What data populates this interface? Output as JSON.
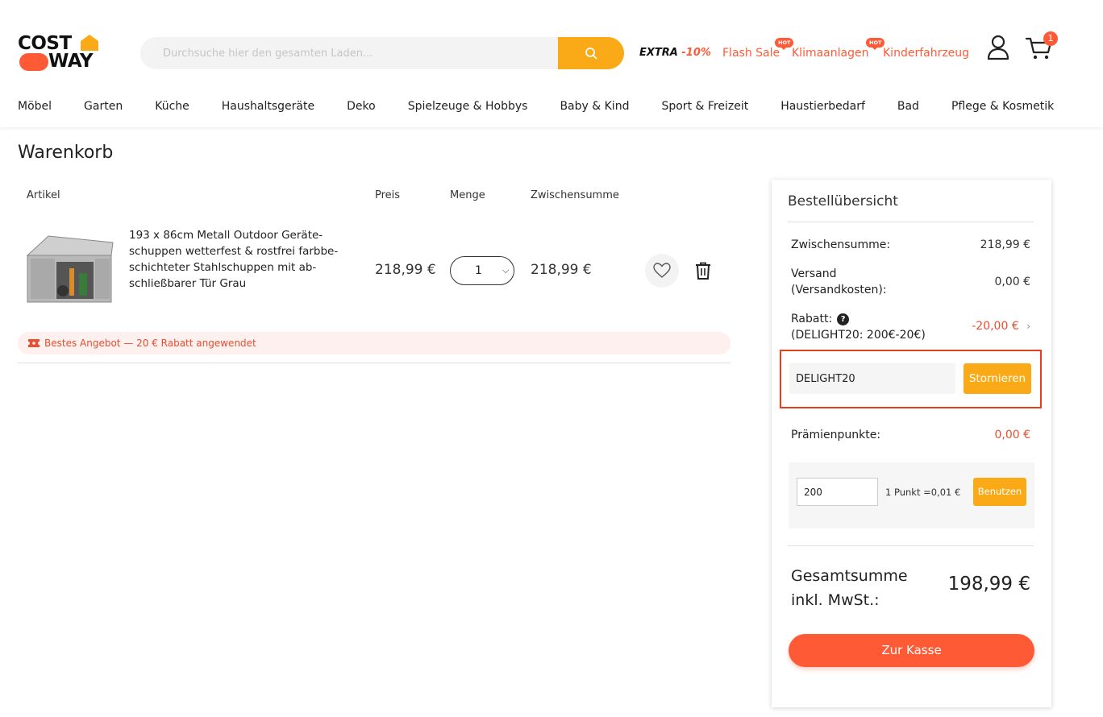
{
  "header": {
    "logo_top": "COST",
    "logo_bottom": "WAY",
    "search_placeholder": "Durchsuche hier den gesamten Laden...",
    "promo_extra": "EXTRA",
    "promo_extra_pct": "-10%",
    "links": [
      {
        "label": "Flash Sale",
        "hot": false
      },
      {
        "label": "Klimaanlagen",
        "hot": true
      },
      {
        "label": "Kinderfahrzeug",
        "hot": true
      }
    ],
    "hot_badge": "HOT",
    "cart_count": "1"
  },
  "nav": [
    "Möbel",
    "Garten",
    "Küche",
    "Haushaltsgeräte",
    "Deko",
    "Spielzeuge & Hobbys",
    "Baby & Kind",
    "Sport & Freizeit",
    "Haustierbedarf",
    "Bad",
    "Pflege & Kosmetik"
  ],
  "cart": {
    "title": "Warenkorb",
    "columns": {
      "item": "Artikel",
      "price": "Preis",
      "qty": "Menge",
      "subtotal": "Zwischensumme"
    },
    "items": [
      {
        "name": "193 x 86cm Metall Outdoor Geräte-schuppen wetterfest & rostfrei farbbe-schichteter Stahlschuppen mit ab-schließbarer Tür Grau",
        "price": "218,99 €",
        "qty": "1",
        "subtotal": "218,99 €"
      }
    ],
    "banner": "Bestes Angebot — 20 € Rabatt angewendet"
  },
  "summary": {
    "title": "Bestellübersicht",
    "subtotal_label": "Zwischensumme:",
    "subtotal_value": "218,99 €",
    "shipping_label": "Versand (Versandkosten):",
    "shipping_value": "0,00 €",
    "discount_label": "Rabatt:",
    "discount_code_label": "(DELIGHT20: 200€-20€)",
    "discount_value": "-20,00 €",
    "coupon_value": "DELIGHT20",
    "coupon_button": "Stornieren",
    "points_label": "Prämienpunkte:",
    "points_value": "0,00 €",
    "points_input": "200",
    "points_rate": "1 Punkt =0,01 €",
    "points_button": "Benutzen",
    "total_label": "Gesamtsumme inkl. MwSt.:",
    "total_value": "198,99 €",
    "checkout_button": "Zur Kasse"
  },
  "colors": {
    "brand_orange": "#ff5a36",
    "accent_yellow": "#fbaa17",
    "highlight_border": "#e0401e"
  }
}
